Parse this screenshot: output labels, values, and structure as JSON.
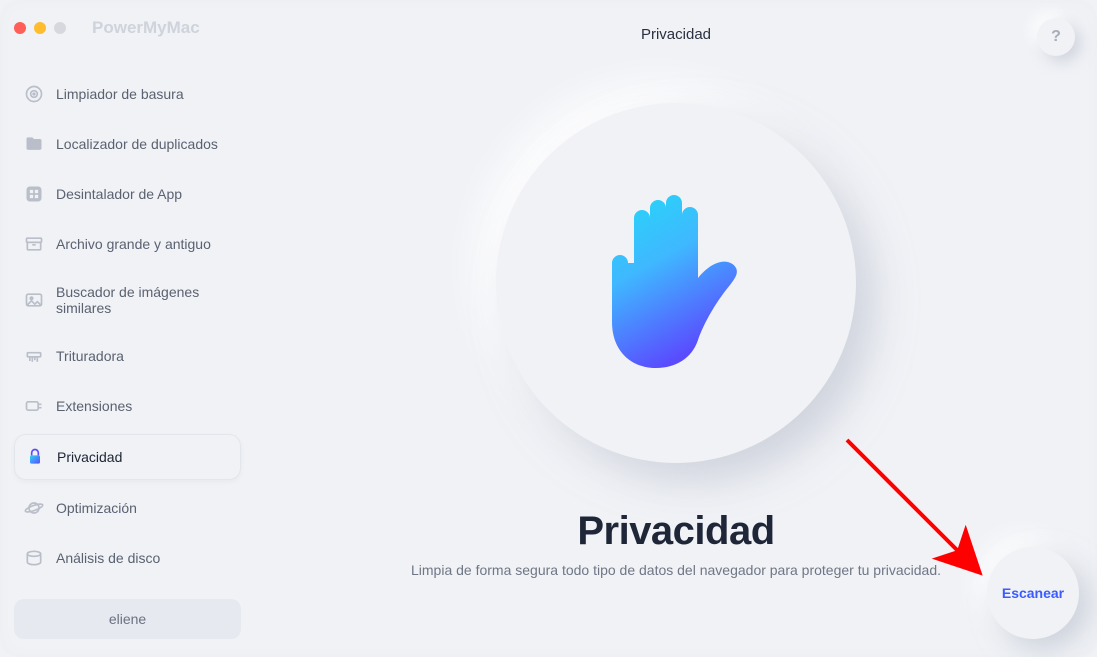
{
  "app": {
    "name": "PowerMyMac"
  },
  "header": {
    "title": "Privacidad",
    "help": "?"
  },
  "sidebar": {
    "items": [
      {
        "label": "Limpiador de basura",
        "icon": "target-icon"
      },
      {
        "label": "Localizador de duplicados",
        "icon": "folder-icon"
      },
      {
        "label": "Desintalador de App",
        "icon": "app-grid-icon"
      },
      {
        "label": "Archivo grande y antiguo",
        "icon": "archive-icon"
      },
      {
        "label": "Buscador de imágenes similares",
        "icon": "image-icon"
      },
      {
        "label": "Trituradora",
        "icon": "shredder-icon"
      },
      {
        "label": "Extensiones",
        "icon": "plugin-icon"
      },
      {
        "label": "Privacidad",
        "icon": "lock-icon"
      },
      {
        "label": "Optimización",
        "icon": "planet-icon"
      },
      {
        "label": "Análisis de disco",
        "icon": "disk-icon"
      }
    ],
    "active_index": 7
  },
  "user": {
    "name": "eliene"
  },
  "hero": {
    "title": "Privacidad",
    "subtitle": "Limpia de forma segura todo tipo de datos del navegador para proteger tu privacidad."
  },
  "scan": {
    "label": "Escanear"
  },
  "annotation": {
    "arrow_points_to": "scan-button"
  }
}
